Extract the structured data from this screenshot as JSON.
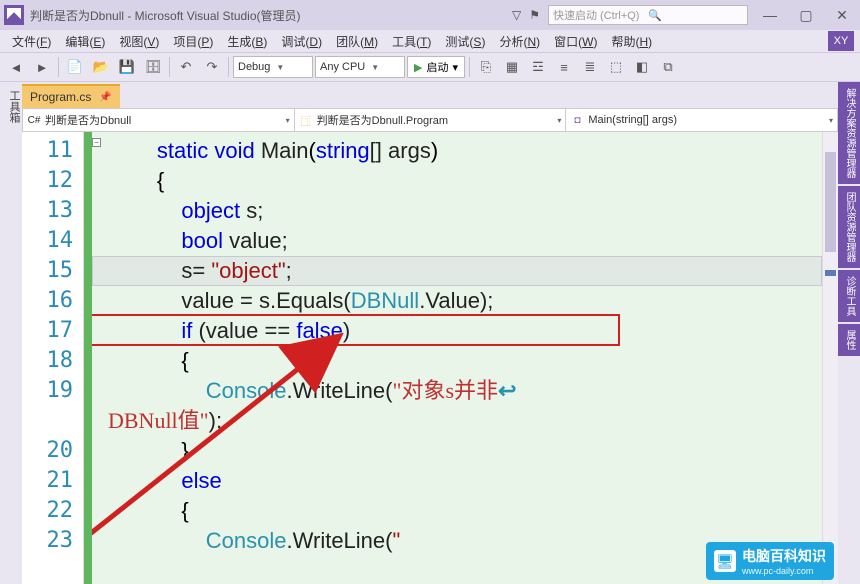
{
  "titlebar": {
    "title": "判断是否为Dbnull - Microsoft Visual Studio(管理员)",
    "quick_launch_placeholder": "快速启动 (Ctrl+Q)"
  },
  "menubar": {
    "items": [
      {
        "label": "文件",
        "key": "F"
      },
      {
        "label": "编辑",
        "key": "E"
      },
      {
        "label": "视图",
        "key": "V"
      },
      {
        "label": "项目",
        "key": "P"
      },
      {
        "label": "生成",
        "key": "B"
      },
      {
        "label": "调试",
        "key": "D"
      },
      {
        "label": "团队",
        "key": "M"
      },
      {
        "label": "工具",
        "key": "T"
      },
      {
        "label": "测试",
        "key": "S"
      },
      {
        "label": "分析",
        "key": "N"
      },
      {
        "label": "窗口",
        "key": "W"
      },
      {
        "label": "帮助",
        "key": "H"
      }
    ],
    "user_badge": "XY"
  },
  "toolbar": {
    "config": "Debug",
    "platform": "Any CPU",
    "start_label": "启动"
  },
  "left_panel_label": "工具箱",
  "right_panels": [
    "解决方案资源管理器",
    "团队资源管理器",
    "诊断工具",
    "属性"
  ],
  "tab": {
    "filename": "Program.cs"
  },
  "nav": {
    "project": "判断是否为Dbnull",
    "class": "判断是否为Dbnull.Program",
    "member": "Main(string[] args)"
  },
  "code": {
    "first_line_no": 11,
    "lines": [
      {
        "n": 11,
        "tokens": [
          [
            "        ",
            ""
          ],
          [
            "static ",
            "kw"
          ],
          [
            "void ",
            "kw"
          ],
          [
            "Main",
            "txt"
          ],
          [
            "(",
            ""
          ],
          [
            "string",
            "kw"
          ],
          [
            "[] ",
            "txt"
          ],
          [
            "args",
            "txt"
          ],
          [
            ")",
            ""
          ]
        ]
      },
      {
        "n": 12,
        "tokens": [
          [
            "        {",
            ""
          ]
        ]
      },
      {
        "n": 13,
        "tokens": [
          [
            "            ",
            ""
          ],
          [
            "object ",
            "kw"
          ],
          [
            "s;",
            "txt"
          ]
        ]
      },
      {
        "n": 14,
        "tokens": [
          [
            "            ",
            ""
          ],
          [
            "bool ",
            "kw"
          ],
          [
            "value;",
            "txt"
          ]
        ]
      },
      {
        "n": 15,
        "tokens": [
          [
            "            s= ",
            "txt"
          ],
          [
            "\"object\"",
            "str"
          ],
          [
            ";",
            "txt"
          ]
        ],
        "current": true
      },
      {
        "n": 16,
        "tokens": [
          [
            "            value = s.Equals(",
            "txt"
          ],
          [
            "DBNull",
            "type"
          ],
          [
            ".Value);",
            "txt"
          ]
        ]
      },
      {
        "n": 17,
        "tokens": [
          [
            "            ",
            ""
          ],
          [
            "if ",
            "kw"
          ],
          [
            "(value == ",
            "txt"
          ],
          [
            "false",
            "kw"
          ],
          [
            ")",
            "txt"
          ]
        ],
        "highlight": true
      },
      {
        "n": 18,
        "tokens": [
          [
            "            {",
            ""
          ]
        ]
      },
      {
        "n": 19,
        "tokens": [
          [
            "                ",
            ""
          ],
          [
            "Console",
            "type"
          ],
          [
            ".WriteLine(",
            "txt"
          ],
          [
            "\"对象s并非",
            "strcn"
          ]
        ],
        "wrap": true
      },
      {
        "n": "",
        "tokens": [
          [
            "DBNull值\"",
            "strcn"
          ],
          [
            ");",
            "txt"
          ]
        ],
        "continuation": true
      },
      {
        "n": 20,
        "tokens": [
          [
            "            }",
            ""
          ]
        ]
      },
      {
        "n": 21,
        "tokens": [
          [
            "            ",
            ""
          ],
          [
            "else",
            "kw"
          ]
        ]
      },
      {
        "n": 22,
        "tokens": [
          [
            "            {",
            ""
          ]
        ]
      },
      {
        "n": 23,
        "tokens": [
          [
            "                ",
            ""
          ],
          [
            "Console",
            "type"
          ],
          [
            ".WriteLine(",
            "txt"
          ],
          [
            "\"",
            "str"
          ]
        ]
      }
    ]
  },
  "watermark": {
    "title": "电脑百科知识",
    "url": "www.pc-daily.com"
  }
}
